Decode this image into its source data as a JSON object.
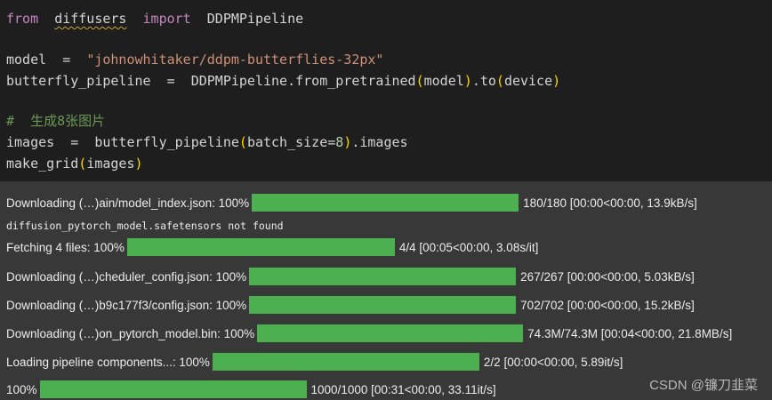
{
  "code": {
    "line1": {
      "kw_from": "from",
      "module": "diffusers",
      "kw_import": "import",
      "cls": "DDPMPipeline"
    },
    "line2": {
      "var": "model",
      "eq": "=",
      "str": "\"johnowhitaker/ddpm-butterflies-32px\""
    },
    "line3": {
      "var": "butterfly_pipeline",
      "eq": "=",
      "call": "DDPMPipeline.from_pretrained",
      "arg": "model",
      "dot": ".to",
      "arg2": "device"
    },
    "comment": "#  生成8张图片",
    "line5": {
      "var": "images",
      "eq": "=",
      "fn": "butterfly_pipeline",
      "arg_name": "batch_size=",
      "arg_val": "8",
      "attr": ".images"
    },
    "line6": {
      "fn": "make_grid",
      "arg": "images"
    }
  },
  "output": {
    "rows": [
      {
        "label": "Downloading (…)ain/model_index.json: 100%",
        "progress": 1.0,
        "stats": "180/180 [00:00<00:00, 13.9kB/s]"
      },
      {
        "label": "Fetching 4 files: 100%",
        "progress": 1.0,
        "stats": "4/4 [00:05<00:00, 3.08s/it]"
      },
      {
        "label": "Downloading (…)cheduler_config.json: 100%",
        "progress": 1.0,
        "stats": "267/267 [00:00<00:00, 5.03kB/s]"
      },
      {
        "label": "Downloading (…)b9c177f3/config.json: 100%",
        "progress": 1.0,
        "stats": "702/702 [00:00<00:00, 15.2kB/s]"
      },
      {
        "label": "Downloading (…)on_pytorch_model.bin: 100%",
        "progress": 1.0,
        "stats": "74.3M/74.3M [00:04<00:00, 21.8MB/s]"
      },
      {
        "label": "Loading pipeline components...: 100%",
        "progress": 1.0,
        "stats": "2/2 [00:00<00:00, 5.89it/s]"
      },
      {
        "label": "100%",
        "progress": 1.0,
        "stats": "1000/1000 [00:31<00:00, 33.11it/s]"
      }
    ],
    "plain_message": "diffusion_pytorch_model.safetensors not found"
  },
  "watermark": "CSDN @镰刀韭菜",
  "colors": {
    "progress_bar": "#4caf50",
    "output_bg": "#383838",
    "editor_bg": "#1e1e1e"
  }
}
